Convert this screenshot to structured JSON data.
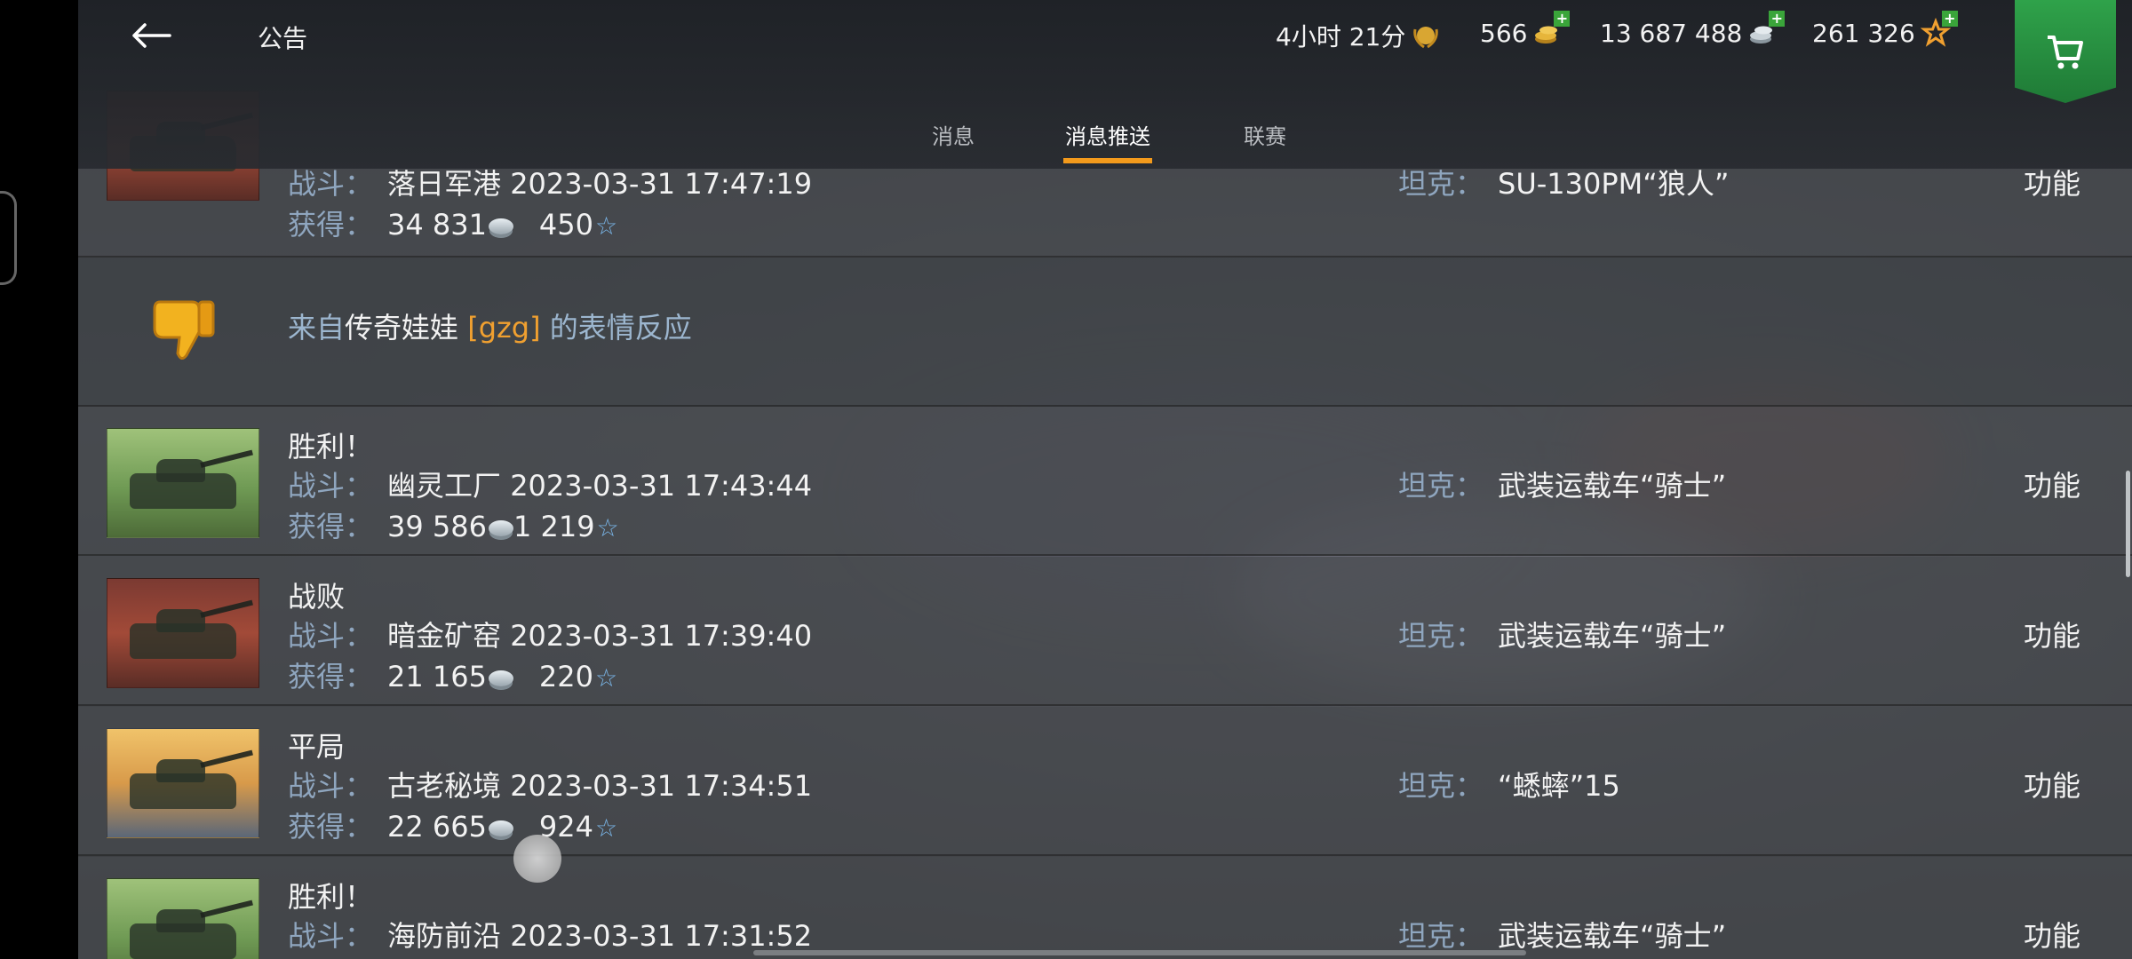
{
  "header": {
    "title": "公告",
    "premium_time": "4小时 21分",
    "gold": "566",
    "silver": "13 687 488",
    "free_xp": "261 326"
  },
  "tabs": [
    {
      "label": "消息",
      "active": false
    },
    {
      "label": "消息推送",
      "active": true
    },
    {
      "label": "联赛",
      "active": false
    }
  ],
  "labels": {
    "battle": "战斗：",
    "earned": "获得：",
    "tank": "坦克：",
    "function": "功能"
  },
  "reaction": {
    "prefix": "来自",
    "player": "传奇娃娃",
    "clan": "[gzg]",
    "suffix": " 的表情反应"
  },
  "rows": [
    {
      "result": "",
      "map": "落日军港",
      "datetime": "2023-03-31 17:47:19",
      "credits": "34 831",
      "xp": "450",
      "tank": "SU-130PM“狼人”",
      "thumb": "defeat"
    },
    {
      "result": "胜利！",
      "map": "幽灵工厂",
      "datetime": "2023-03-31 17:43:44",
      "credits": "39 586",
      "xp": "1 219",
      "tank": "武装运载车“骑士”",
      "thumb": "victory"
    },
    {
      "result": "战败",
      "map": "暗金矿窑",
      "datetime": "2023-03-31 17:39:40",
      "credits": "21 165",
      "xp": "220",
      "tank": "武装运载车“骑士”",
      "thumb": "defeat"
    },
    {
      "result": "平局",
      "map": "古老秘境",
      "datetime": "2023-03-31 17:34:51",
      "credits": "22 665",
      "xp": "924",
      "tank": "“蟋蟀”15",
      "thumb": "draw"
    },
    {
      "result": "胜利！",
      "map": "海防前沿",
      "datetime": "2023-03-31 17:31:52",
      "credits": "",
      "xp": "",
      "tank": "武装运载车“骑士”",
      "thumb": "victory"
    }
  ],
  "icons": {
    "back": "arrow-left-icon",
    "premium": "premium-laurel-icon",
    "gold": "gold-coins-icon",
    "silver": "silver-coins-icon",
    "xp": "star-icon",
    "cart": "shopping-cart-icon",
    "reaction": "thumbs-down-icon"
  },
  "colors": {
    "accent": "#f39a1c",
    "label": "#8fa6bf",
    "clan": "#f0a030",
    "shop": "#2fa24a"
  }
}
